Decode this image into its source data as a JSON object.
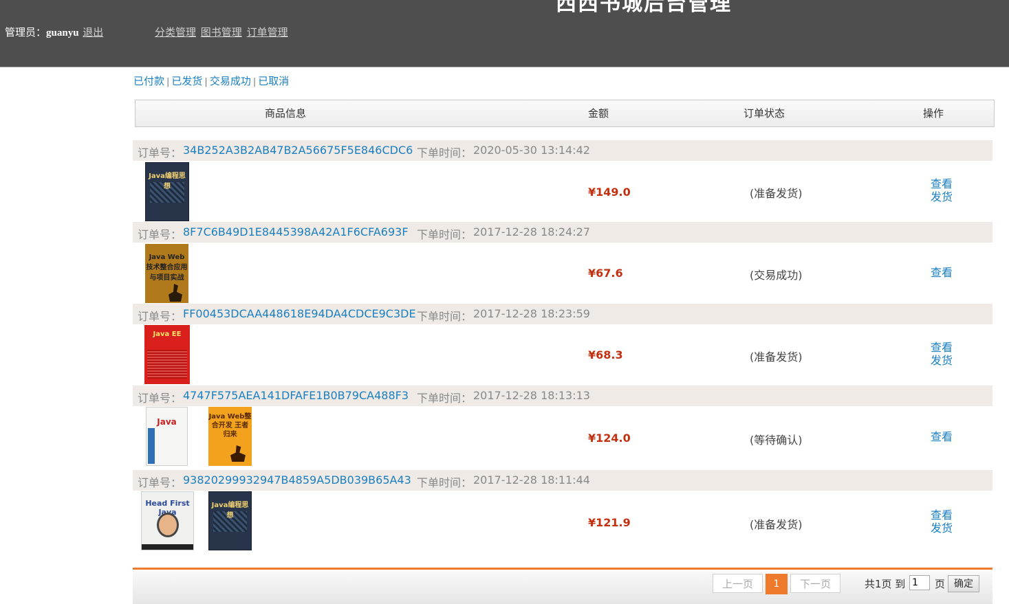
{
  "header": {
    "site_title": "西西书城后台管理",
    "admin_label": "管理员：",
    "admin_name": "guanyu",
    "logout": "退出",
    "nav": [
      "分类管理",
      "图书管理",
      "订单管理"
    ]
  },
  "filters": [
    "已付款",
    "已发货",
    "交易成功",
    "已取消"
  ],
  "filter_separator": "|",
  "columns": [
    "商品信息",
    "金额",
    "订单状态",
    "操作"
  ],
  "order_no_label": "订单号：",
  "order_time_label": "下单时间：",
  "orders": [
    {
      "order_no": "34B252A3B2AB47B2A56675F5E846CDC6",
      "time": "2020-05-30 13:14:42",
      "amount": "¥149.0",
      "status": "(准备发货)",
      "actions": [
        "查看",
        "发货"
      ],
      "covers": [
        {
          "title": "Java编程思想",
          "icon": "book-cover-java-thinking"
        }
      ]
    },
    {
      "order_no": "8F7C6B49D1E8445398A42A1F6CFA693F",
      "time": "2017-12-28 18:24:27",
      "amount": "¥67.6",
      "status": "(交易成功)",
      "actions": [
        "查看"
      ],
      "covers": [
        {
          "title": "Java Web 技术整合应用与项目实战",
          "icon": "book-cover-javaweb-tech"
        }
      ]
    },
    {
      "order_no": "FF00453DCAA448618E94DA4CDCE9C3DE",
      "time": "2017-12-28 18:23:59",
      "amount": "¥68.3",
      "status": "(准备发货)",
      "actions": [
        "查看",
        "发货"
      ],
      "covers": [
        {
          "title": "Java EE",
          "icon": "book-cover-javaee-red"
        }
      ]
    },
    {
      "order_no": "4747F575AEA141DFAFE1B0B79CA488F3",
      "time": "2017-12-28 18:13:13",
      "amount": "¥124.0",
      "status": "(等待确认)",
      "actions": [
        "查看"
      ],
      "covers": [
        {
          "title": "Java",
          "icon": "book-cover-java-white"
        },
        {
          "title": "Java Web整合开发 王者归来",
          "icon": "book-cover-javaweb-king"
        }
      ]
    },
    {
      "order_no": "93820299932947B4859A5DB039B65A43",
      "time": "2017-12-28 18:11:44",
      "amount": "¥121.9",
      "status": "(准备发货)",
      "actions": [
        "查看",
        "发货"
      ],
      "covers": [
        {
          "title": "Head First Java",
          "icon": "book-cover-headfirst-java"
        },
        {
          "title": "Java编程思想",
          "icon": "book-cover-java-thinking"
        }
      ]
    }
  ],
  "pager": {
    "prev": "上一页",
    "current": "1",
    "next": "下一页",
    "total_prefix": "共1页 到",
    "page_input": "1",
    "page_suffix": "页",
    "confirm": "确定"
  },
  "colors": {
    "header_bg": "#4e4e4e",
    "link": "#1a7fc1",
    "amount": "#c3300f",
    "accent": "#f07a2c",
    "order_head_bg": "#efeae5"
  }
}
